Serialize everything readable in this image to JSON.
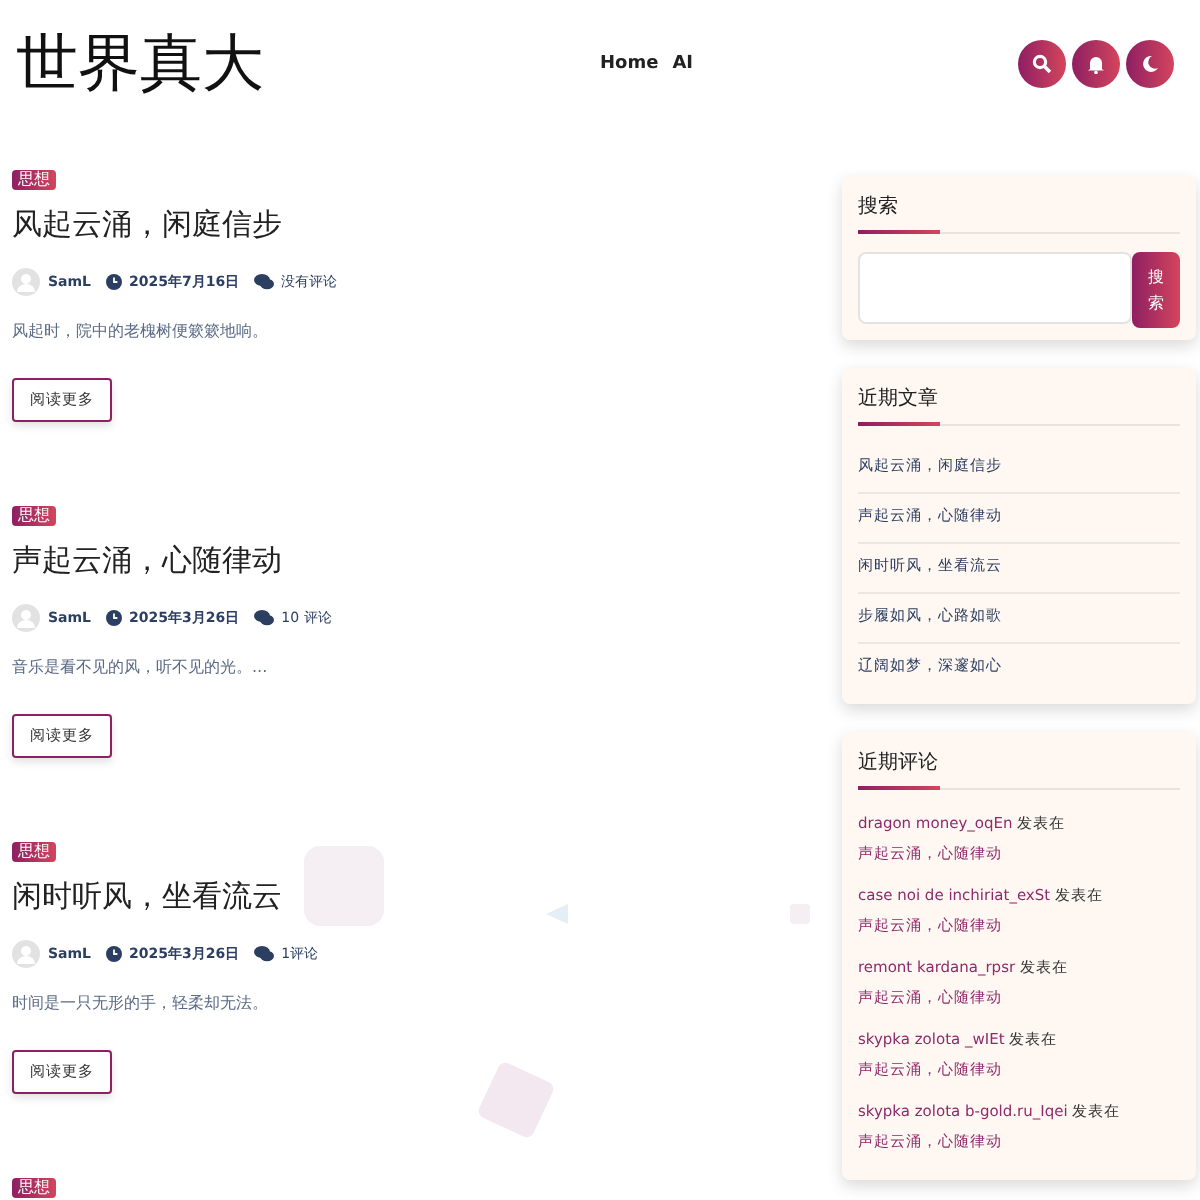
{
  "site_title": "世界真大",
  "nav": [
    "Home",
    "AI"
  ],
  "posts": [
    {
      "category": "思想",
      "title": "风起云涌，闲庭信步",
      "author": "SamL",
      "date": "2025年7月16日",
      "comments": "没有评论",
      "excerpt": "风起时，院中的老槐树便簌簌地响。",
      "button": "阅读更多"
    },
    {
      "category": "思想",
      "title": "声起云涌，心随律动",
      "author": "SamL",
      "date": "2025年3月26日",
      "comments": "10 评论",
      "excerpt": "音乐是看不见的风，听不见的光。...",
      "button": "阅读更多"
    },
    {
      "category": "思想",
      "title": "闲时听风，坐看流云",
      "author": "SamL",
      "date": "2025年3月26日",
      "comments": "1评论",
      "excerpt": "时间是一只无形的手，轻柔却无法。",
      "button": "阅读更多"
    },
    {
      "category": "思想"
    }
  ],
  "search_widget": {
    "title": "搜索",
    "button": "搜索"
  },
  "recent_posts": {
    "title": "近期文章",
    "items": [
      "风起云涌，闲庭信步",
      "声起云涌，心随律动",
      "闲时听风，坐看流云",
      "步履如风，心路如歌",
      "辽阔如梦，深邃如心"
    ]
  },
  "recent_comments": {
    "title": "近期评论",
    "items": [
      {
        "author": "dragon money_oqEn",
        "text": "发表在",
        "post": "声起云涌，心随律动"
      },
      {
        "author": "case noi de inchiriat_exSt",
        "text": "发表在",
        "post": "声起云涌，心随律动"
      },
      {
        "author": "remont kardana_rpsr",
        "text": "发表在",
        "post": "声起云涌，心随律动"
      },
      {
        "author": "skypka zolota _wIEt",
        "text": "发表在",
        "post": "声起云涌，心随律动"
      },
      {
        "author": "skypka zolota b-gold.ru_Iqei",
        "text": "发表在",
        "post": "声起云涌，心随律动"
      }
    ]
  }
}
